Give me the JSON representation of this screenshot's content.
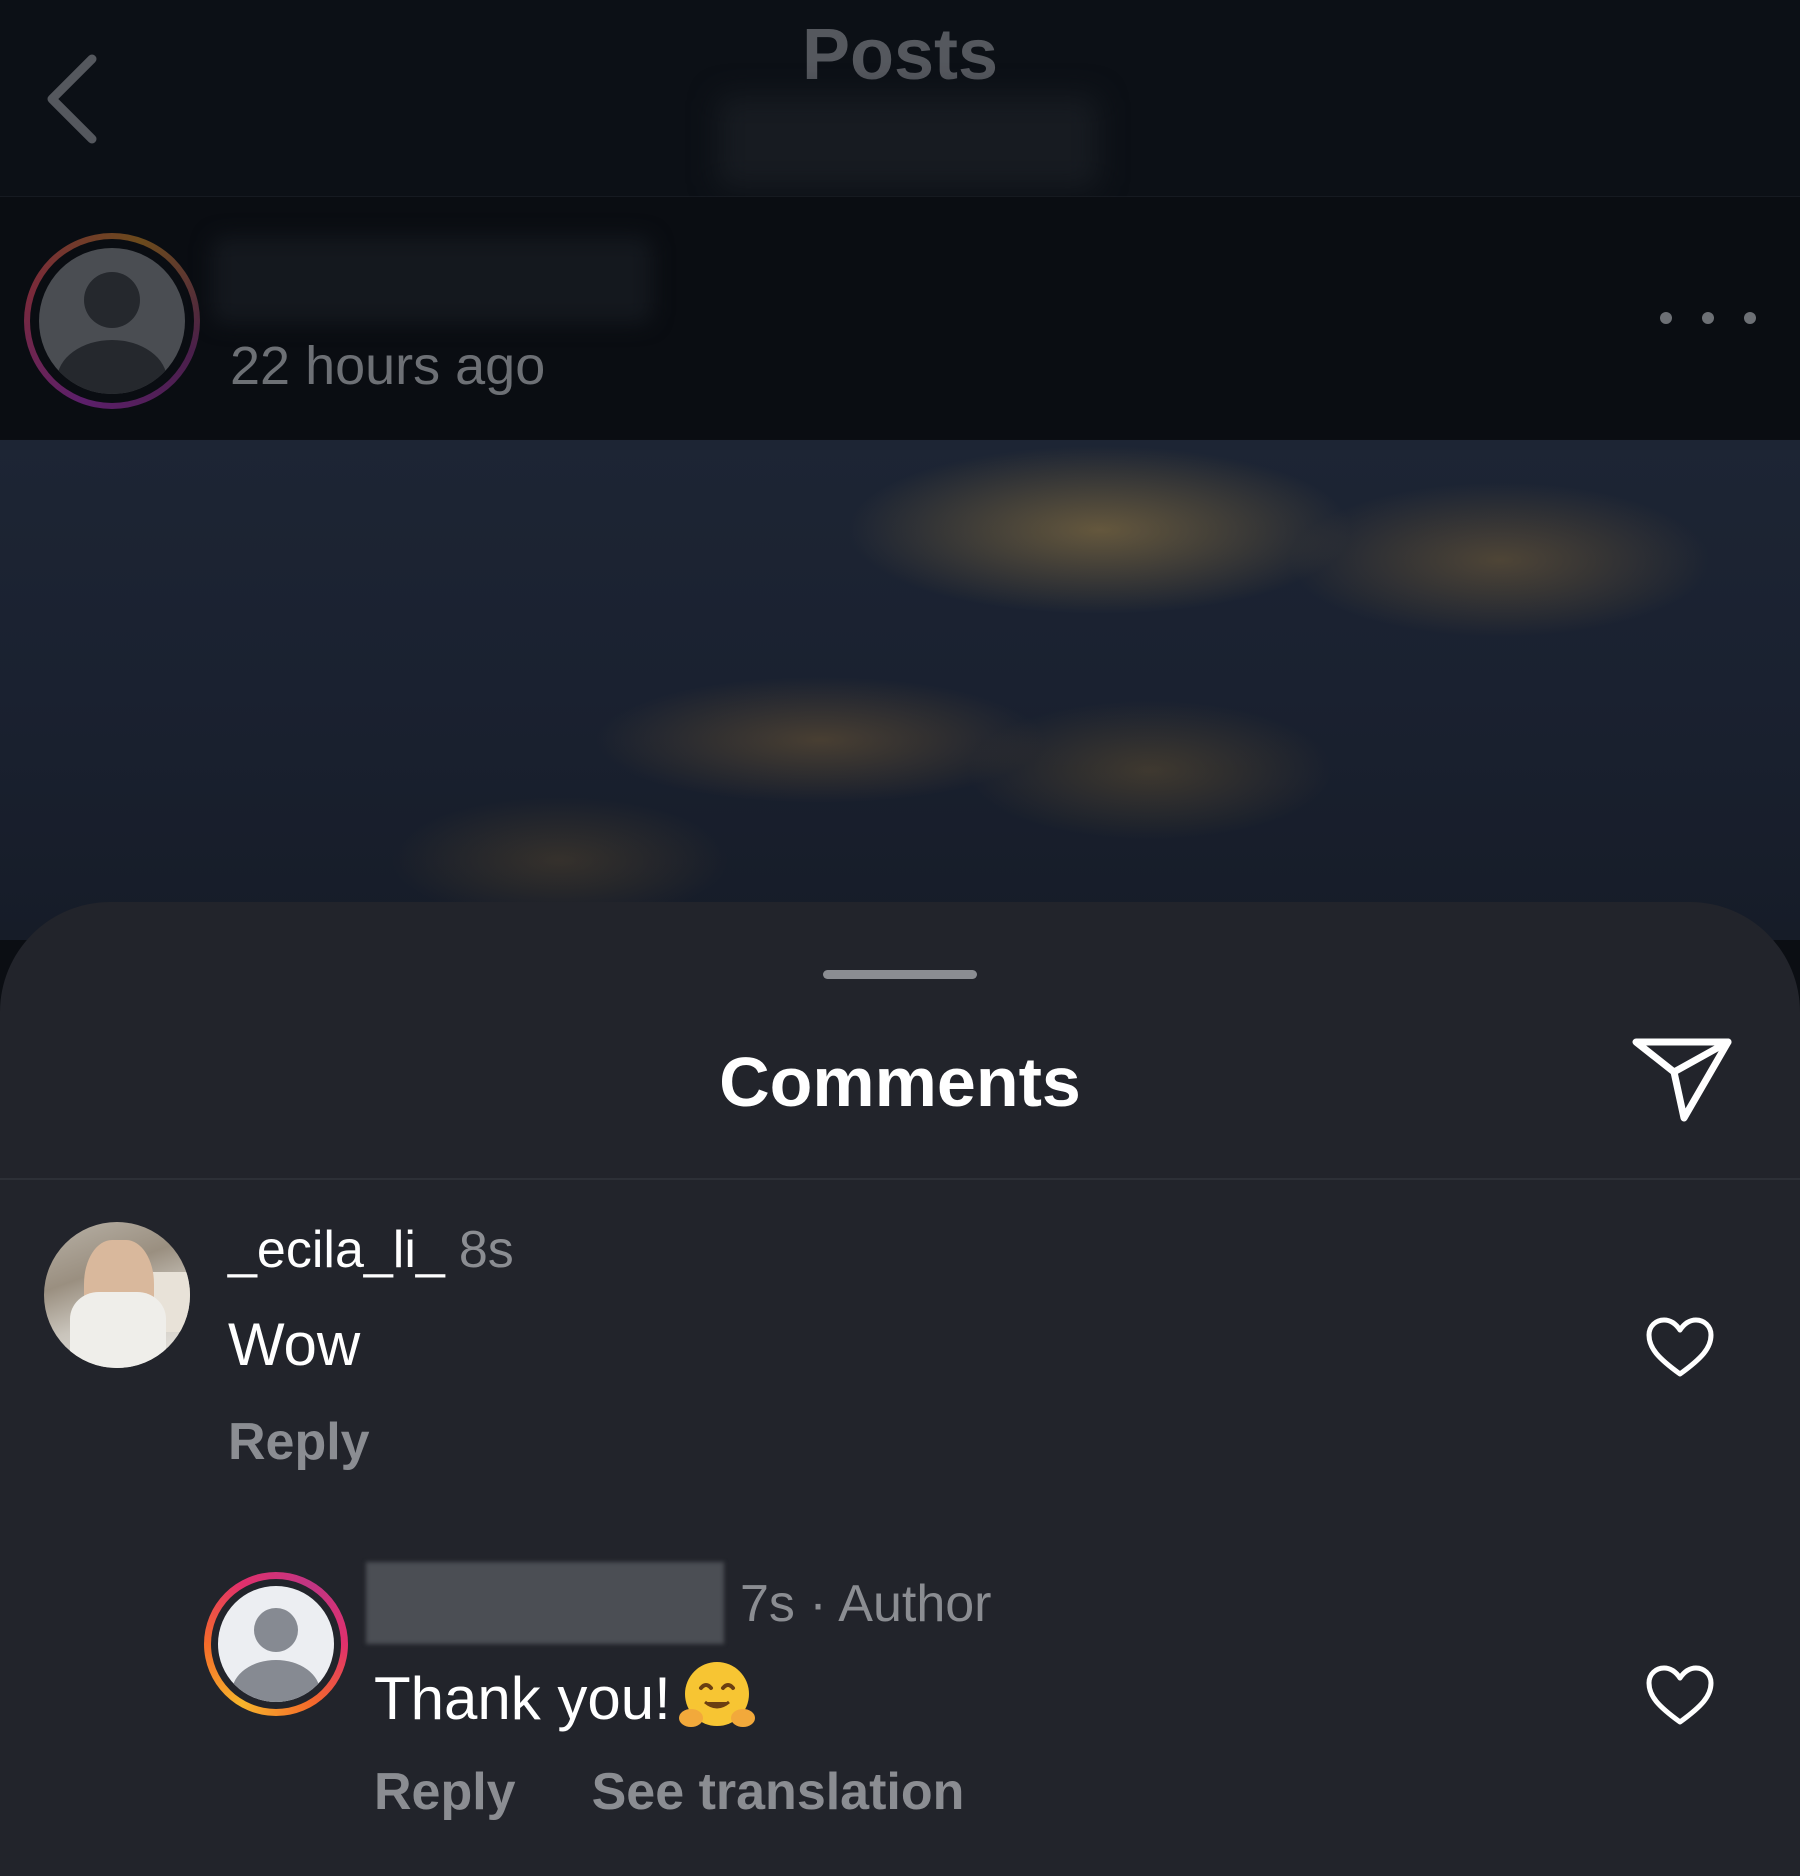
{
  "topbar": {
    "title": "Posts",
    "back_icon": "chevron-left-icon"
  },
  "post": {
    "time": "22 hours ago",
    "more_icon": "more-horizontal-icon"
  },
  "comments_sheet": {
    "title": "Comments",
    "share_icon": "send-icon",
    "comments": [
      {
        "username": "_ecila_li_",
        "time": "8s",
        "text": "Wow",
        "reply_label": "Reply",
        "like_icon": "heart-outline-icon"
      },
      {
        "meta": "7s · Author",
        "text": "Thank you!",
        "emoji": "hugging-face-emoji",
        "reply_label": "Reply",
        "translate_label": "See translation",
        "like_icon": "heart-outline-icon"
      }
    ]
  },
  "colors": {
    "background": "#0b0e13",
    "sheet": "#22242b",
    "primary_text": "#ffffff",
    "secondary_text": "#8b8d92",
    "story_ring_gradient": [
      "#f7b52c",
      "#f56b2a",
      "#e1306c",
      "#c13584"
    ]
  }
}
